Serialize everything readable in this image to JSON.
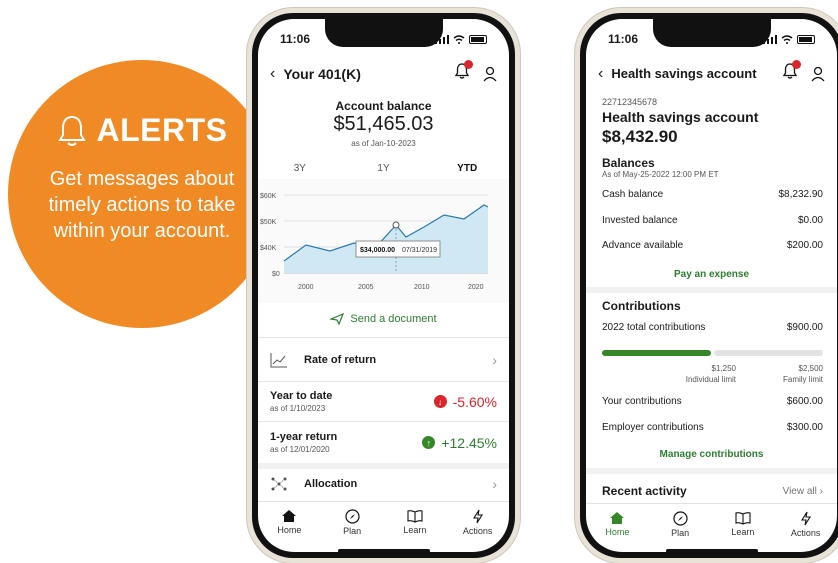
{
  "promo": {
    "title": "ALERTS",
    "text": "Get messages about timely actions to take within your account.",
    "color": "#f08a24"
  },
  "phone1": {
    "status_time": "11:06",
    "header_title": "Your 401(K)",
    "balance_label": "Account balance",
    "balance_value": "$51,465.03",
    "balance_date": "as of Jan-10-2023",
    "range_tabs": [
      "3Y",
      "1Y",
      "YTD"
    ],
    "active_range": "YTD",
    "chart": {
      "y_ticks": [
        "$60K",
        "$50K",
        "$40K",
        "$0"
      ],
      "x_ticks": [
        "2000",
        "2005",
        "2010",
        "2020"
      ],
      "tooltip_value": "$34,000.00",
      "tooltip_date": "07/31/2019"
    },
    "send_document": "Send a document",
    "rate_of_return": "Rate of return",
    "ytd_title": "Year to date",
    "ytd_date": "as of 1/10/2023",
    "ytd_value": "-5.60%",
    "one_year_title": "1-year return",
    "one_year_date": "as of 12/01/2020",
    "one_year_value": "+12.45%",
    "allocation": "Allocation",
    "tabs": [
      "Home",
      "Plan",
      "Learn",
      "Actions"
    ]
  },
  "phone2": {
    "status_time": "11:06",
    "header_title": "Health savings account",
    "account_number": "22712345678",
    "account_name": "Health savings account",
    "account_balance": "$8,432.90",
    "balances_title": "Balances",
    "balances_asof": "As of May-25-2022 12:00 PM ET",
    "cash_label": "Cash balance",
    "cash_value": "$8,232.90",
    "invested_label": "Invested balance",
    "invested_value": "$0.00",
    "advance_label": "Advance available",
    "advance_value": "$200.00",
    "pay_expense": "Pay an expense",
    "contrib_title": "Contributions",
    "total_label": "2022 total contributions",
    "total_value": "$900.00",
    "individual_limit_value": "$1,250",
    "individual_limit_label": "Individual limit",
    "family_limit_value": "$2,500",
    "family_limit_label": "Family limit",
    "your_label": "Your contributions",
    "your_value": "$600.00",
    "employer_label": "Employer contributions",
    "employer_value": "$300.00",
    "manage": "Manage contributions",
    "recent_title": "Recent activity",
    "view_all": "View all",
    "tabs": [
      "Home",
      "Plan",
      "Learn",
      "Actions"
    ],
    "active_tab": "Home",
    "accent_color": "#2e7d32"
  }
}
